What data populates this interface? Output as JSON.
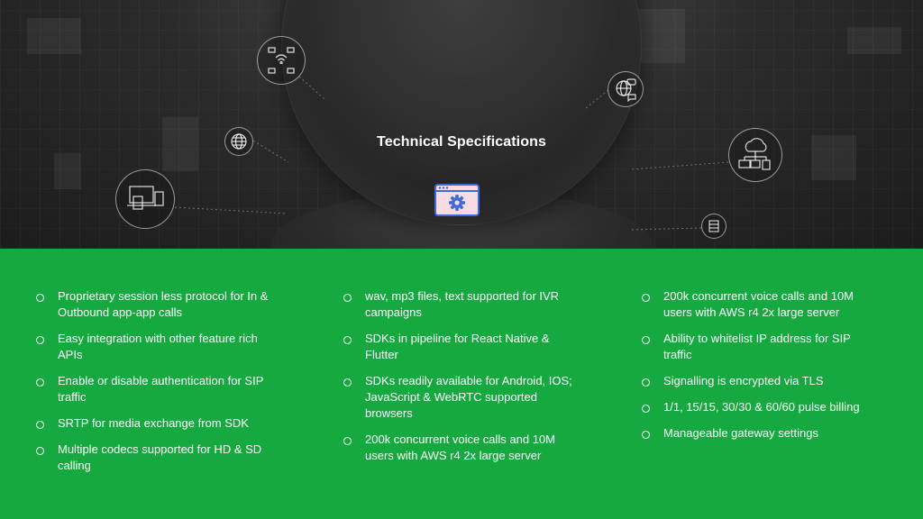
{
  "slide": {
    "title": "Technical Specifications",
    "icons": {
      "header": "gear-window-icon",
      "orbit": [
        "wifi-devices-icon",
        "globe-icon",
        "devices-icon",
        "chat-globe-icon",
        "cloud-network-icon",
        "database-icon"
      ]
    },
    "colors": {
      "accent_green": "#15a93f",
      "hero_dark": "#2b2b2b",
      "icon_blue": "#3f6bd9",
      "icon_pink": "#f7dbe2"
    }
  },
  "columns": [
    {
      "items": [
        "Proprietary session less protocol for In & Outbound app-app calls",
        "Easy integration with other feature rich APIs",
        "Enable or disable authentication for SIP traffic",
        "SRTP for media exchange from SDK",
        "Multiple codecs supported for HD & SD calling"
      ]
    },
    {
      "items": [
        "wav, mp3 files, text supported for IVR campaigns",
        "SDKs in pipeline for React Native & Flutter",
        "SDKs readily available for Android, IOS; JavaScript & WebRTC supported browsers",
        "200k concurrent voice calls and 10M users with AWS r4 2x large server"
      ]
    },
    {
      "items": [
        "200k concurrent voice calls and 10M users with AWS r4 2x large server",
        "Ability to whitelist IP address for SIP traffic",
        "Signalling is encrypted via TLS",
        "1/1, 15/15, 30/30 & 60/60 pulse billing",
        "Manageable gateway settings"
      ]
    }
  ]
}
